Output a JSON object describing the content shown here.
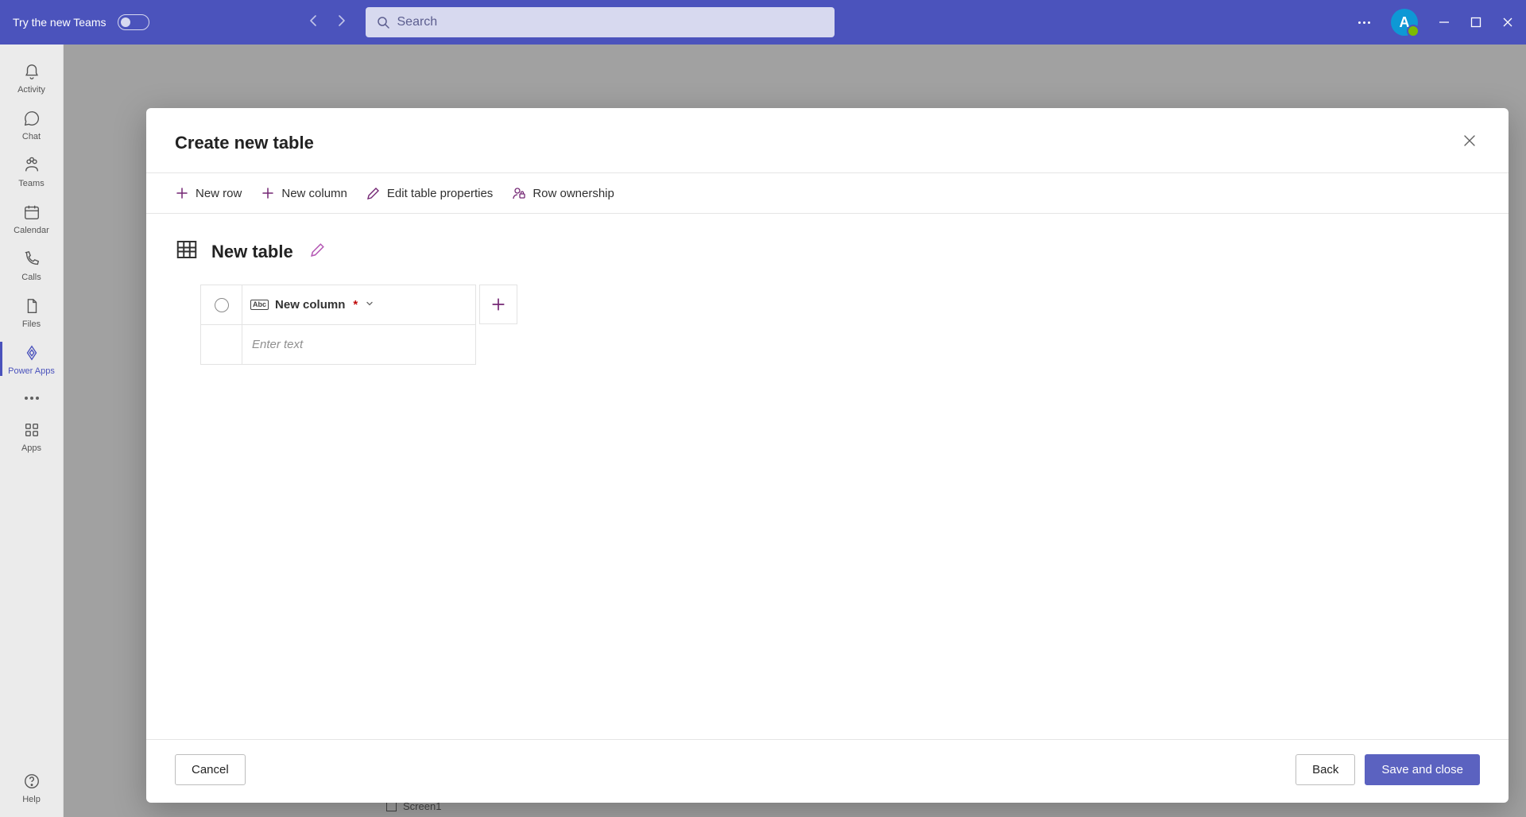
{
  "titlebar": {
    "try_teams_label": "Try the new Teams",
    "search_placeholder": "Search",
    "avatar_initial": "A"
  },
  "rail": {
    "items": [
      {
        "label": "Activity"
      },
      {
        "label": "Chat"
      },
      {
        "label": "Teams"
      },
      {
        "label": "Calendar"
      },
      {
        "label": "Calls"
      },
      {
        "label": "Files"
      },
      {
        "label": "Power Apps"
      }
    ],
    "apps_label": "Apps",
    "help_label": "Help"
  },
  "dialog": {
    "title": "Create new table",
    "toolbar": {
      "new_row": "New row",
      "new_column": "New column",
      "edit_props": "Edit table properties",
      "row_ownership": "Row ownership"
    },
    "table_name": "New table",
    "column_header": "New column",
    "cell_placeholder": "Enter text",
    "footer": {
      "cancel": "Cancel",
      "back": "Back",
      "save_close": "Save and close"
    }
  },
  "background": {
    "screen_label": "Screen1"
  }
}
